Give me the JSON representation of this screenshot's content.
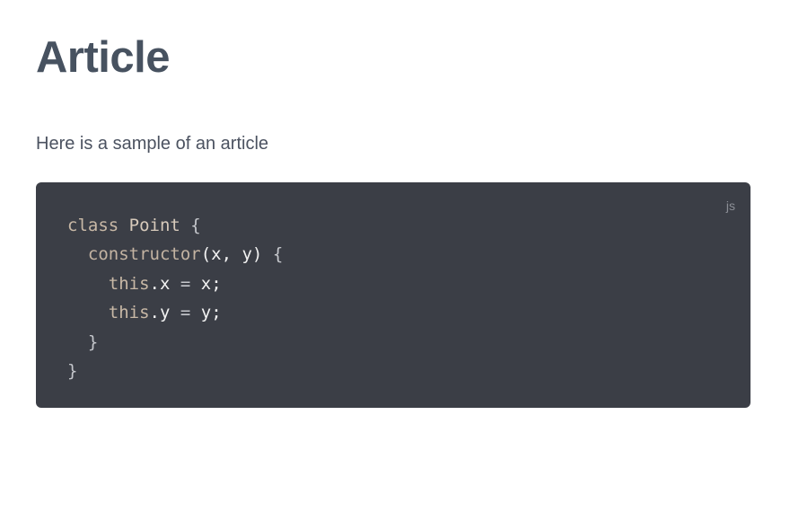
{
  "article": {
    "title": "Article",
    "intro": "Here is a sample of an article"
  },
  "code_block": {
    "language": "js",
    "background_color": "#3b3e46",
    "lines": [
      [
        {
          "text": "class",
          "kind": "kw"
        },
        {
          "text": " ",
          "kind": "plain"
        },
        {
          "text": "Point",
          "kind": "name"
        },
        {
          "text": " {",
          "kind": "punc"
        }
      ],
      [
        {
          "text": "  ",
          "kind": "plain"
        },
        {
          "text": "constructor",
          "kind": "fn"
        },
        {
          "text": "(x, y)",
          "kind": "plain"
        },
        {
          "text": " {",
          "kind": "punc"
        }
      ],
      [
        {
          "text": "    ",
          "kind": "plain"
        },
        {
          "text": "this",
          "kind": "kw"
        },
        {
          "text": ".x",
          "kind": "plain"
        },
        {
          "text": " = ",
          "kind": "punc"
        },
        {
          "text": "x;",
          "kind": "plain"
        }
      ],
      [
        {
          "text": "    ",
          "kind": "plain"
        },
        {
          "text": "this",
          "kind": "kw"
        },
        {
          "text": ".y",
          "kind": "plain"
        },
        {
          "text": " = ",
          "kind": "punc"
        },
        {
          "text": "y;",
          "kind": "plain"
        }
      ],
      [
        {
          "text": "  }",
          "kind": "punc"
        }
      ],
      [
        {
          "text": "}",
          "kind": "punc"
        }
      ]
    ]
  }
}
